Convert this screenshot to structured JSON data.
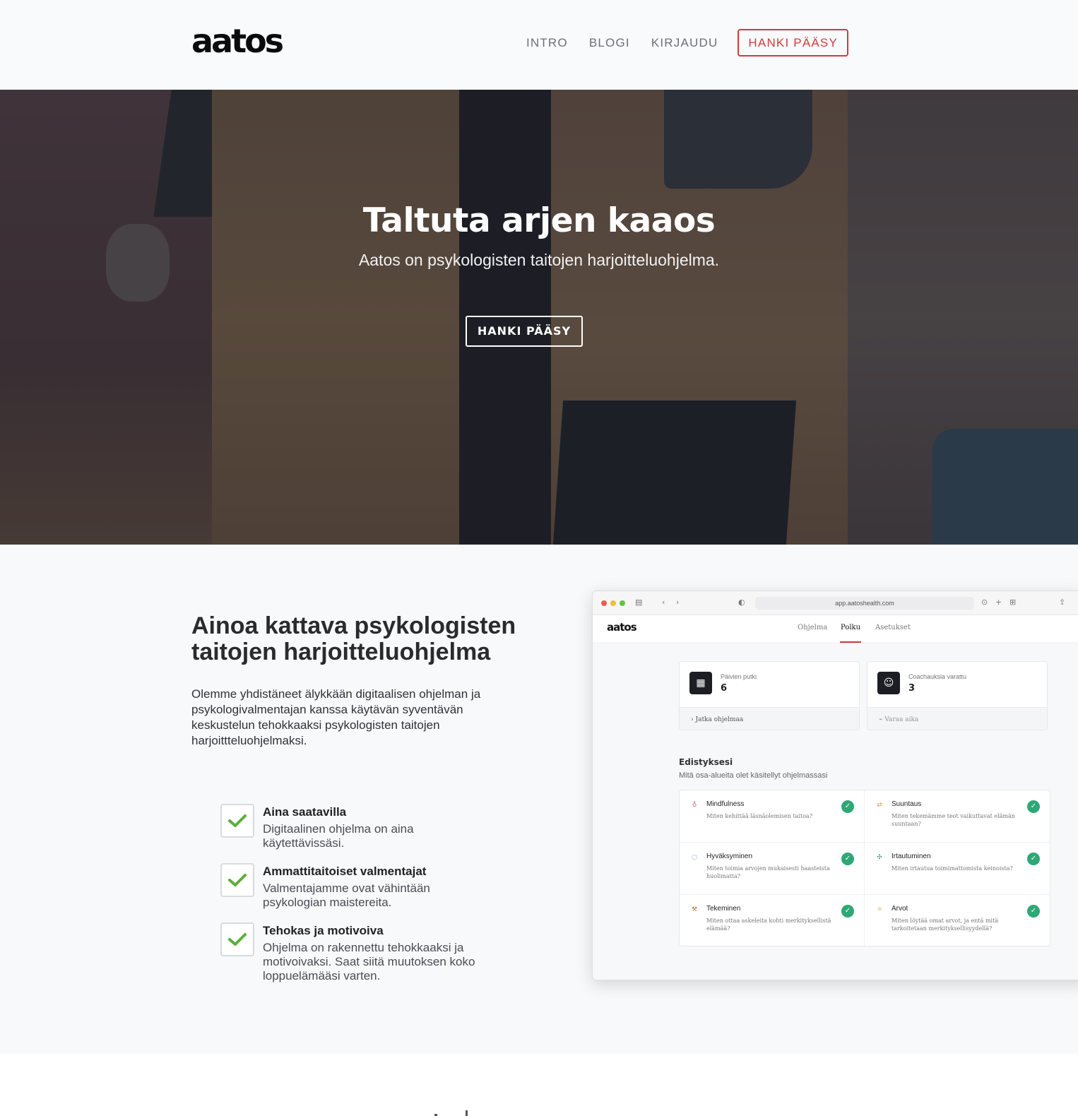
{
  "header": {
    "logo": "aatos",
    "nav": [
      "INTRO",
      "BLOGI",
      "KIRJAUDU"
    ],
    "cta": "HANKI PÄÄSY"
  },
  "hero": {
    "title": "Taltuta arjen kaaos",
    "subtitle": "Aatos on psykologisten taitojen harjoitteluohjelma.",
    "button": "HANKI PÄÄSY"
  },
  "features": {
    "title": "Ainoa kattava psykologisten taitojen harjoitteluohjelma",
    "description": "Olemme yhdistäneet älykkään digitaalisen ohjelman ja psykologivalmentajan kanssa käytävän syventävän keskustelun tehokkaaksi psykologisten taitojen harjoittteluohjelmaksi.",
    "items": [
      {
        "title": "Aina saatavilla",
        "text": "Digitaalinen ohjelma on aina käytettävissäsi."
      },
      {
        "title": "Ammattitaitoiset valmentajat",
        "text": "Valmentajamme ovat vähintään psykologian maistereita."
      },
      {
        "title": "Tehokas ja motivoiva",
        "text": "Ohjelma on rakennettu tehokkaaksi ja motivoivaksi. Saat siitä muutoksen koko loppuelämääsi varten."
      }
    ],
    "check_color": "#5cae3c"
  },
  "app_preview": {
    "url": "app.aatoshealth.com",
    "logo": "aatos",
    "tabs": [
      "Ohjelma",
      "Polku",
      "Asetukset"
    ],
    "active_tab": "Polku",
    "stats": [
      {
        "label": "Päivien putki",
        "value": "6",
        "footer": "Jatka ohjelmaa",
        "icon": "calendar-icon"
      },
      {
        "label": "Coachauksia varattu",
        "value": "3",
        "footer": "Varaa aika",
        "icon": "coach-icon"
      }
    ],
    "progress_title": "Edistyksesi",
    "progress_subtitle": "Mitä osa-alueita olet käsitellyt ohjelmassasi",
    "areas": [
      {
        "title": "Mindfulness",
        "text": "Miten kehittää läsnäolemisen taitoa?",
        "icon_color": "#e06060"
      },
      {
        "title": "Suuntaus",
        "text": "Miten tekemämme teot vaikuttavat elämän suuntaan?",
        "icon_color": "#d9a020"
      },
      {
        "title": "Hyväksyminen",
        "text": "Miten toimia arvojen mukaisesti haasteista huolimatta?",
        "icon_color": "#4a78c8"
      },
      {
        "title": "Irtautuminen",
        "text": "Miten irtautua toimimattomista keinoista?",
        "icon_color": "#3aa070"
      },
      {
        "title": "Tekeminen",
        "text": "Miten ottaa askeleita kohti merkityksellistä elämää?",
        "icon_color": "#c07a2a"
      },
      {
        "title": "Arvot",
        "text": "Miten löytää omat arvot, ja entä mitä tarkoitetaan merkityksellisyydellä?",
        "icon_color": "#d9a020"
      }
    ],
    "badge_color": "#2fa776"
  },
  "colors": {
    "accent": "#d33a3a",
    "page_bg": "#f7f9fb"
  }
}
